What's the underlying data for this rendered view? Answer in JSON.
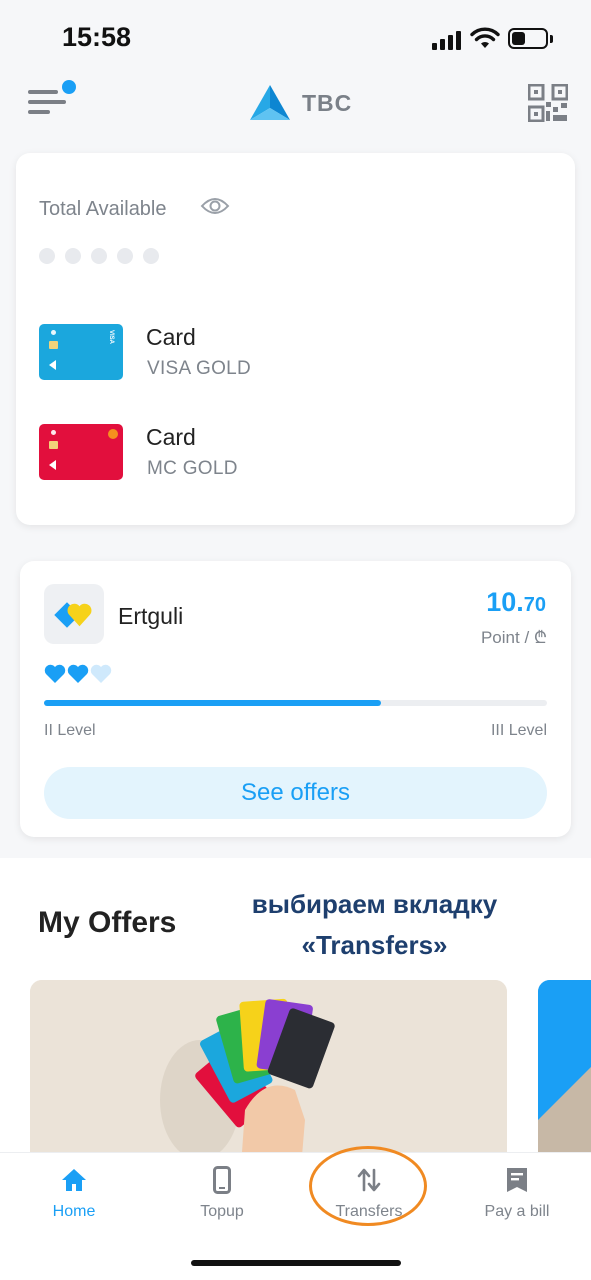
{
  "status_bar": {
    "time": "15:58"
  },
  "header": {
    "logo_text": "TBC"
  },
  "balance": {
    "label": "Total Available",
    "cards": [
      {
        "name": "Card",
        "type": "VISA GOLD",
        "color": "#1ba7dd"
      },
      {
        "name": "Card",
        "type": "MC GOLD",
        "color": "#e20f3d"
      }
    ]
  },
  "loyalty": {
    "name": "Ertguli",
    "points_int": "10.",
    "points_dec": "70",
    "points_unit": "Point / ₾",
    "hearts_filled": 2,
    "hearts_total": 3,
    "progress": 0.67,
    "level_current": "II Level",
    "level_next": "III Level",
    "offers_button": "See offers"
  },
  "offers": {
    "title": "My Offers",
    "annotation": "выбираем вкладку «Transfers»"
  },
  "bottom_nav": {
    "items": [
      {
        "label": "Home",
        "icon": "home-icon",
        "active": true
      },
      {
        "label": "Topup",
        "icon": "phone-icon",
        "active": false
      },
      {
        "label": "Transfers",
        "icon": "transfer-arrows-icon",
        "active": false
      },
      {
        "label": "Pay a bill",
        "icon": "bill-icon",
        "active": false
      }
    ]
  },
  "colors": {
    "accent": "#1a9ff5",
    "highlight": "#f08a22",
    "annotation": "#1e3f6e"
  }
}
